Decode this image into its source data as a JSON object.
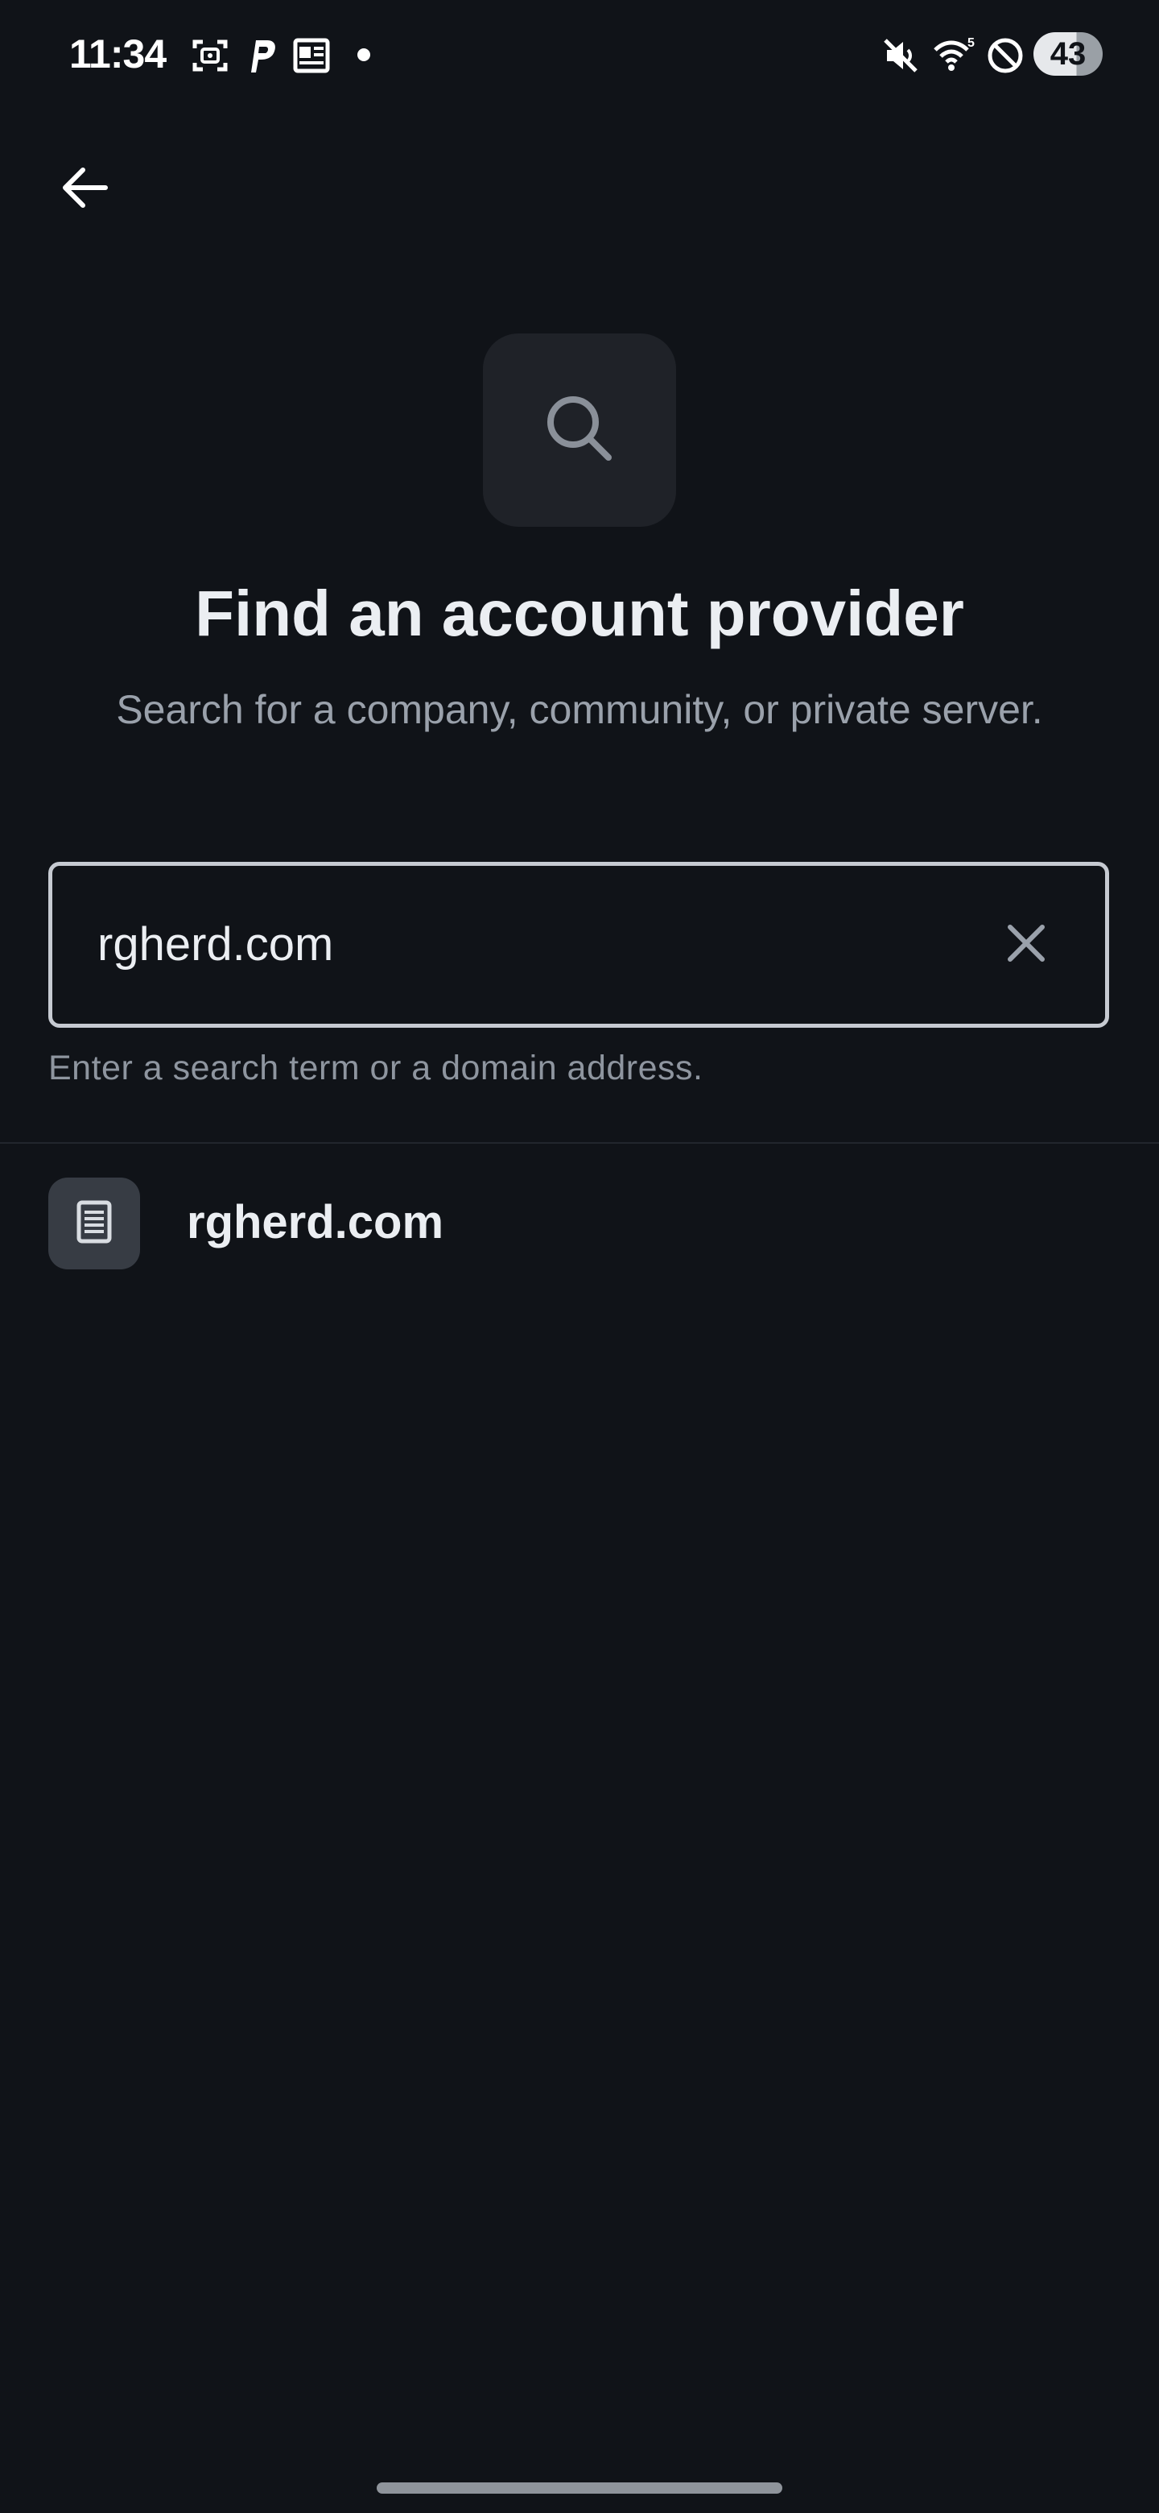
{
  "status_bar": {
    "time": "11:34",
    "battery_level": "43",
    "icons": [
      "screenshot-icon",
      "paypal-icon",
      "news-icon",
      "notification-dot-icon",
      "mute-icon",
      "wifi-icon",
      "do-not-disturb-icon"
    ]
  },
  "nav": {
    "back_icon": "arrow-left-icon"
  },
  "header": {
    "icon": "search-icon",
    "title": "Find an account provider",
    "subtitle": "Search for a company, community, or private server."
  },
  "search": {
    "value": "rgherd.com",
    "clear_icon": "close-icon",
    "helper": "Enter a search term or a domain address."
  },
  "results": [
    {
      "icon": "server-icon",
      "label": "rgherd.com"
    }
  ],
  "colors": {
    "background": "#101318",
    "tile": "#1f2228",
    "result_tile": "#373c44",
    "text_primary": "#ebeef2",
    "text_secondary": "#9aa1ab",
    "field_border": "#c6cad1"
  }
}
